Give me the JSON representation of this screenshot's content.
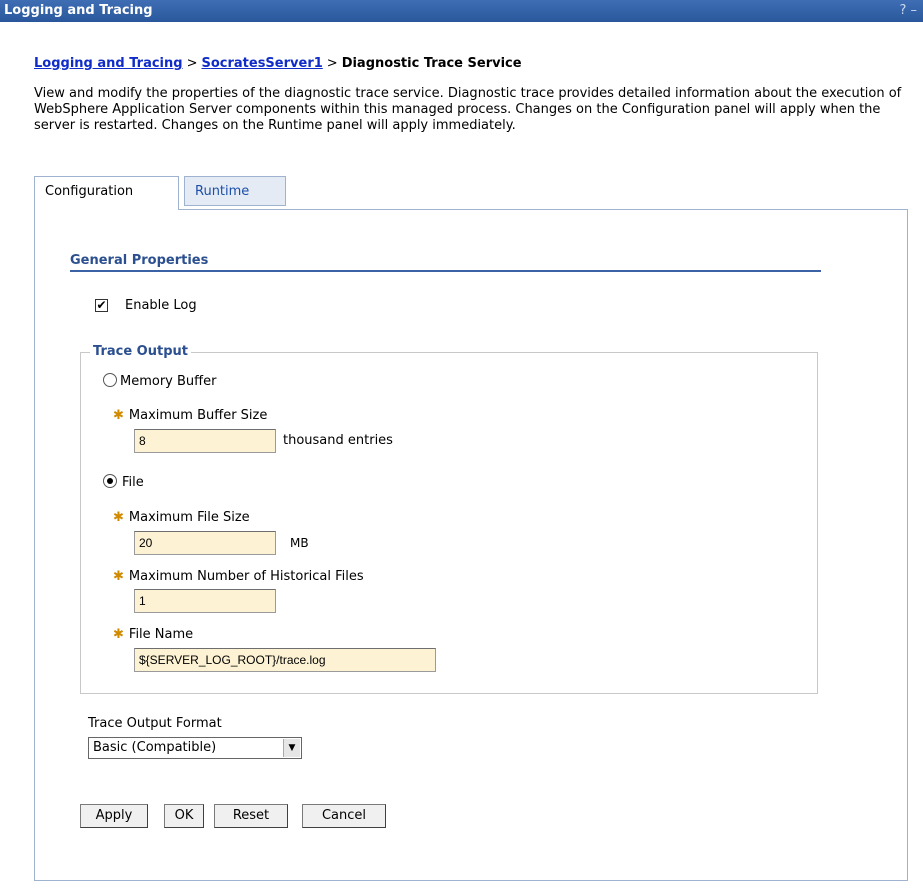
{
  "window": {
    "title": "Logging and Tracing",
    "help": "? –"
  },
  "breadcrumb": {
    "link1": "Logging and Tracing",
    "sep": ">",
    "link2": "SocratesServer1",
    "current": "Diagnostic Trace Service"
  },
  "description": "View and modify the properties of the diagnostic trace service. Diagnostic trace provides detailed information about the execution of WebSphere Application Server components within this managed process. Changes on the Configuration panel will apply when the server is restarted. Changes on the Runtime panel will apply immediately.",
  "tabs": {
    "configuration": "Configuration",
    "runtime": "Runtime"
  },
  "general_properties": {
    "title": "General Properties",
    "enable_log": {
      "label": "Enable Log",
      "checked": true
    }
  },
  "trace_output": {
    "legend": "Trace Output",
    "memory_buffer": {
      "label": "Memory Buffer",
      "selected": false,
      "max_buffer_label": "Maximum Buffer Size",
      "max_buffer_value": "8",
      "max_buffer_unit": "thousand entries"
    },
    "file": {
      "label": "File",
      "selected": true,
      "max_file_size_label": "Maximum File Size",
      "max_file_size_value": "20",
      "max_file_size_unit": "MB",
      "historical_label": "Maximum Number of Historical Files",
      "historical_value": "1",
      "file_name_label": "File Name",
      "file_name_value": "${SERVER_LOG_ROOT}/trace.log"
    }
  },
  "format": {
    "label": "Trace Output Format",
    "selected": "Basic (Compatible)"
  },
  "buttons": {
    "apply": "Apply",
    "ok": "OK",
    "reset": "Reset",
    "cancel": "Cancel"
  },
  "colors": {
    "titlebar": "#2f5ea6",
    "link": "#0f2cc8",
    "section_title": "#2b4f8f",
    "input_background": "#fdf3d4",
    "required_marker": "#d08a00"
  }
}
